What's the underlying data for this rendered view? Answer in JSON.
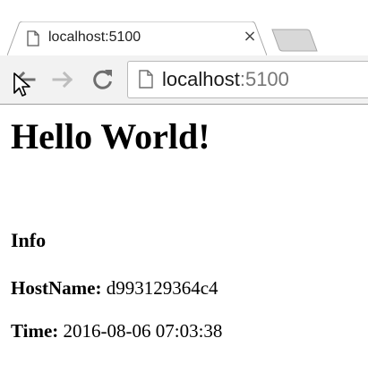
{
  "tab": {
    "title": "localhost:5100",
    "close_glyph": "×",
    "favicon": "page-icon"
  },
  "toolbar": {
    "back_icon": "back-arrow-icon",
    "forward_icon": "forward-arrow-icon",
    "reload_icon": "reload-icon"
  },
  "omnibox": {
    "host": "localhost",
    "port": ":5100"
  },
  "page": {
    "heading": "Hello World!",
    "subheading": "Info",
    "hostname_label": "HostName:",
    "hostname_value": "d993129364c4",
    "time_label": "Time:",
    "time_value": "2016-08-06 07:03:38"
  },
  "colors": {
    "toolbar_bg": "#f2f2f2",
    "tab_border": "#a8a8a8",
    "inactive_tab": "#d8d8d8",
    "icon_gray": "#6e6e6e",
    "icon_disabled": "#bdbdbd"
  }
}
